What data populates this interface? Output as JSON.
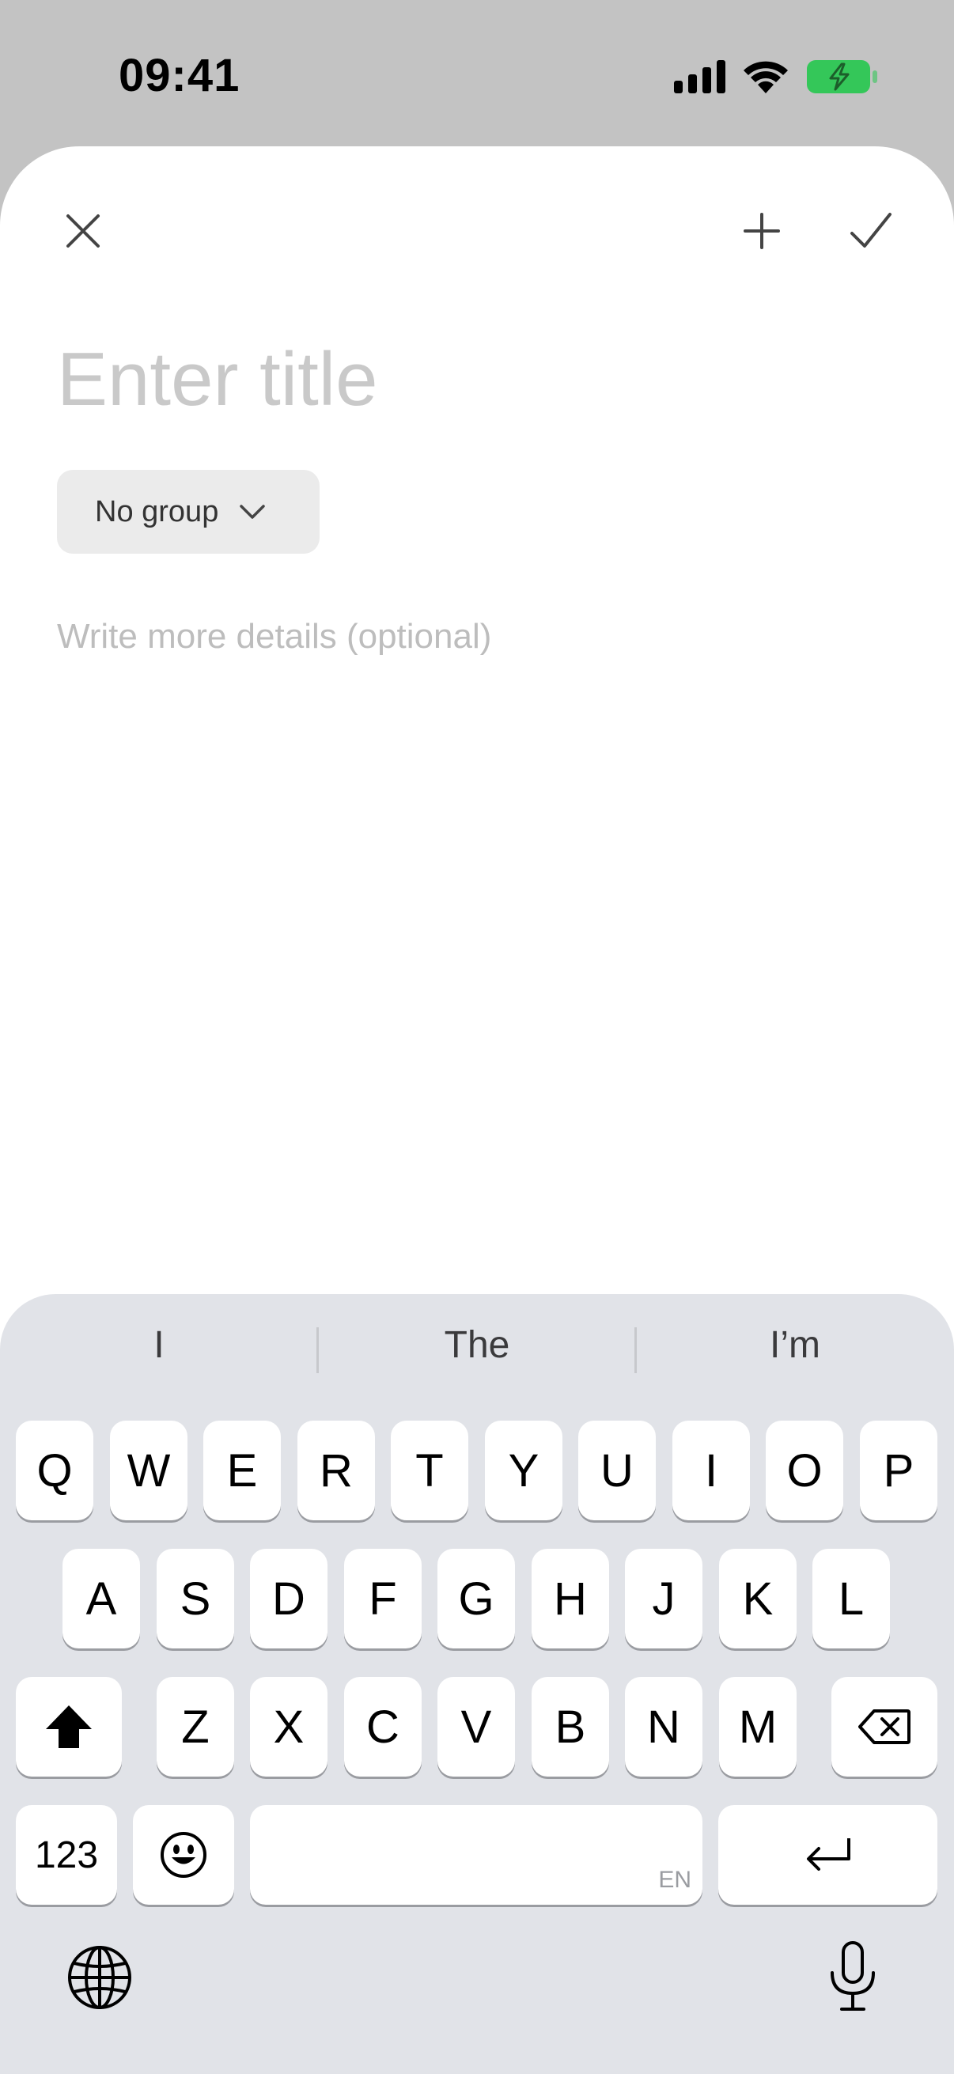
{
  "status_bar": {
    "time": "09:41",
    "battery_color": "#34c759"
  },
  "editor": {
    "title_placeholder": "Enter title",
    "title_value": "",
    "group_label": "No group",
    "details_placeholder": "Write more details (optional)",
    "details_value": ""
  },
  "toolbar": {
    "close_icon": "close-icon",
    "add_icon": "plus-icon",
    "confirm_icon": "checkmark-icon"
  },
  "keyboard": {
    "suggestions": [
      "I",
      "The",
      "I’m"
    ],
    "row1": [
      "Q",
      "W",
      "E",
      "R",
      "T",
      "Y",
      "U",
      "I",
      "O",
      "P"
    ],
    "row2": [
      "A",
      "S",
      "D",
      "F",
      "G",
      "H",
      "J",
      "K",
      "L"
    ],
    "row3": [
      "Z",
      "X",
      "C",
      "V",
      "B",
      "N",
      "M"
    ],
    "numbers_label": "123",
    "space_language": "EN"
  }
}
